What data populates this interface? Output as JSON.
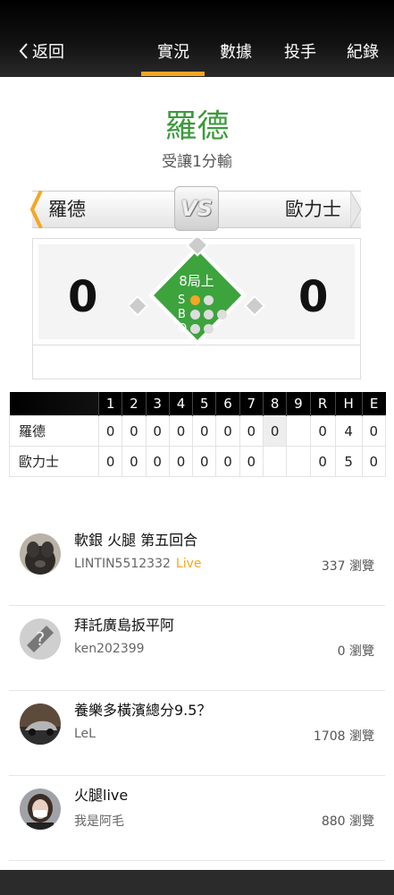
{
  "header": {
    "back_label": "返回",
    "tabs": [
      {
        "label": "實況",
        "active": true
      },
      {
        "label": "數據",
        "active": false
      },
      {
        "label": "投手",
        "active": false
      },
      {
        "label": "紀錄",
        "active": false
      }
    ],
    "accent_color": "#f5a623"
  },
  "game": {
    "leader_team": "羅德",
    "status_text": "受讓1分輸",
    "away_team": "羅德",
    "home_team": "歐力士",
    "vs_label": "VS",
    "away_score": "0",
    "home_score": "0",
    "inning_label": "8局上",
    "count_labels": [
      "S",
      "B",
      "O"
    ],
    "strikes": 1,
    "balls": 0,
    "outs": 0,
    "team_color": "#3d9a3d"
  },
  "boxscore": {
    "headers": [
      "",
      "1",
      "2",
      "3",
      "4",
      "5",
      "6",
      "7",
      "8",
      "9",
      "R",
      "H",
      "E"
    ],
    "rows": [
      {
        "team": "羅德",
        "innings": [
          "0",
          "0",
          "0",
          "0",
          "0",
          "0",
          "0",
          "0",
          ""
        ],
        "R": "0",
        "H": "4",
        "E": "0"
      },
      {
        "team": "歐力士",
        "innings": [
          "0",
          "0",
          "0",
          "0",
          "0",
          "0",
          "0",
          "",
          ""
        ],
        "R": "0",
        "H": "5",
        "E": "0"
      }
    ]
  },
  "posts": [
    {
      "title": "軟銀 火腿 第五回合",
      "author": "LINTIN5512332",
      "badge": "Live",
      "views": "337 瀏覽",
      "avatar": "dog-avatar"
    },
    {
      "title": "拜託廣島扳平阿",
      "author": "ken202399",
      "badge": "",
      "views": "0 瀏覽",
      "avatar": "default-avatar"
    },
    {
      "title": "養樂多橫濱總分9.5？",
      "author": "LeL",
      "badge": "",
      "views": "1708 瀏覽",
      "avatar": "car-avatar"
    },
    {
      "title": "火腿live",
      "author": "我是阿毛",
      "badge": "",
      "views": "880 瀏覽",
      "avatar": "person-avatar"
    }
  ]
}
